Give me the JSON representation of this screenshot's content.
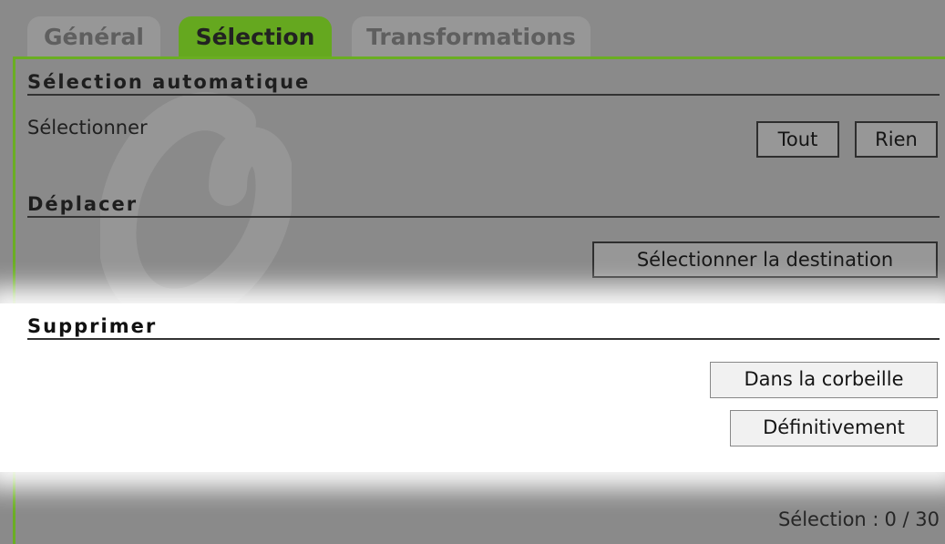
{
  "tabs": [
    {
      "label": "Général",
      "active": false
    },
    {
      "label": "Sélection",
      "active": true
    },
    {
      "label": "Transformations",
      "active": false
    }
  ],
  "sections": {
    "auto_selection": {
      "title": "Sélection automatique",
      "label": "Sélectionner",
      "buttons": {
        "all": "Tout",
        "none": "Rien"
      }
    },
    "move": {
      "title": "Déplacer",
      "buttons": {
        "choose_destination": "Sélectionner la destination"
      }
    },
    "delete": {
      "title": "Supprimer",
      "buttons": {
        "trash": "Dans la corbeille",
        "permanent": "Définitivement"
      }
    }
  },
  "status": {
    "label": "Sélection :",
    "count": "0 / 30"
  },
  "colors": {
    "accent": "#65a81f",
    "background": "#8a8a8a",
    "highlight": "#ffffff"
  },
  "icons": {
    "watermark": "app-logo-watermark-icon"
  }
}
